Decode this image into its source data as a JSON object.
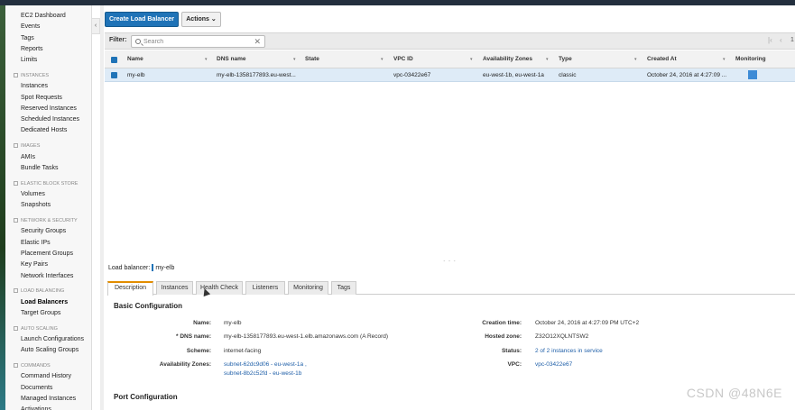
{
  "sidebar": {
    "items": [
      {
        "kind": "link",
        "label": "EC2 Dashboard",
        "name": "sidebar-item-ec2-dashboard"
      },
      {
        "kind": "link",
        "label": "Events",
        "name": "sidebar-item-events"
      },
      {
        "kind": "link",
        "label": "Tags",
        "name": "sidebar-item-tags"
      },
      {
        "kind": "link",
        "label": "Reports",
        "name": "sidebar-item-reports"
      },
      {
        "kind": "link",
        "label": "Limits",
        "name": "sidebar-item-limits"
      },
      {
        "kind": "section",
        "label": "INSTANCES",
        "name": "sidebar-section-instances"
      },
      {
        "kind": "link",
        "label": "Instances",
        "name": "sidebar-item-instances"
      },
      {
        "kind": "link",
        "label": "Spot Requests",
        "name": "sidebar-item-spot-requests"
      },
      {
        "kind": "link",
        "label": "Reserved Instances",
        "name": "sidebar-item-reserved-instances"
      },
      {
        "kind": "link",
        "label": "Scheduled Instances",
        "name": "sidebar-item-scheduled-instances"
      },
      {
        "kind": "link",
        "label": "Dedicated Hosts",
        "name": "sidebar-item-dedicated-hosts"
      },
      {
        "kind": "section",
        "label": "IMAGES",
        "name": "sidebar-section-images"
      },
      {
        "kind": "link",
        "label": "AMIs",
        "name": "sidebar-item-amis"
      },
      {
        "kind": "link",
        "label": "Bundle Tasks",
        "name": "sidebar-item-bundle-tasks"
      },
      {
        "kind": "section",
        "label": "ELASTIC BLOCK STORE",
        "name": "sidebar-section-ebs"
      },
      {
        "kind": "link",
        "label": "Volumes",
        "name": "sidebar-item-volumes"
      },
      {
        "kind": "link",
        "label": "Snapshots",
        "name": "sidebar-item-snapshots"
      },
      {
        "kind": "section",
        "label": "NETWORK & SECURITY",
        "name": "sidebar-section-network-security"
      },
      {
        "kind": "link",
        "label": "Security Groups",
        "name": "sidebar-item-security-groups"
      },
      {
        "kind": "link",
        "label": "Elastic IPs",
        "name": "sidebar-item-elastic-ips"
      },
      {
        "kind": "link",
        "label": "Placement Groups",
        "name": "sidebar-item-placement-groups"
      },
      {
        "kind": "link",
        "label": "Key Pairs",
        "name": "sidebar-item-key-pairs"
      },
      {
        "kind": "link",
        "label": "Network Interfaces",
        "name": "sidebar-item-network-interfaces"
      },
      {
        "kind": "section",
        "label": "LOAD BALANCING",
        "name": "sidebar-section-load-balancing"
      },
      {
        "kind": "link",
        "label": "Load Balancers",
        "name": "sidebar-item-load-balancers",
        "active": true
      },
      {
        "kind": "link",
        "label": "Target Groups",
        "name": "sidebar-item-target-groups"
      },
      {
        "kind": "section",
        "label": "AUTO SCALING",
        "name": "sidebar-section-auto-scaling"
      },
      {
        "kind": "link",
        "label": "Launch Configurations",
        "name": "sidebar-item-launch-configurations"
      },
      {
        "kind": "link",
        "label": "Auto Scaling Groups",
        "name": "sidebar-item-auto-scaling-groups"
      },
      {
        "kind": "section",
        "label": "COMMANDS",
        "name": "sidebar-section-commands"
      },
      {
        "kind": "link",
        "label": "Command History",
        "name": "sidebar-item-command-history"
      },
      {
        "kind": "link",
        "label": "Documents",
        "name": "sidebar-item-documents"
      },
      {
        "kind": "link",
        "label": "Managed Instances",
        "name": "sidebar-item-managed-instances"
      },
      {
        "kind": "link",
        "label": "Activations",
        "name": "sidebar-item-activations"
      }
    ]
  },
  "toolbar": {
    "create_label": "Create Load Balancer",
    "actions_label": "Actions",
    "actions_caret": "⌄"
  },
  "filter": {
    "label": "Filter:",
    "placeholder": "Search",
    "value": "",
    "clear_glyph": "✕"
  },
  "pager": {
    "first_glyph": "|‹",
    "prev_glyph": "‹",
    "page": "1"
  },
  "table": {
    "columns": {
      "name": "Name",
      "dns": "DNS name",
      "state": "State",
      "vpc": "VPC ID",
      "az": "Availability Zones",
      "type": "Type",
      "created": "Created At",
      "monitoring": "Monitoring"
    },
    "sort_caret": "▾",
    "row": {
      "name": "my-elb",
      "dns": "my-elb-1358177893.eu-west...",
      "state": "",
      "vpc": "vpc-03422e67",
      "az": "eu-west-1b, eu-west-1a",
      "type": "classic",
      "created": "October 24, 2016 at 4:27:09 ..."
    }
  },
  "splitter_glyph": "- - -",
  "details": {
    "title_label": "Load balancer:",
    "title_name": "my-elb",
    "tabs": [
      "Description",
      "Instances",
      "Health Check",
      "Listeners",
      "Monitoring",
      "Tags"
    ],
    "basic_heading": "Basic Configuration",
    "port_heading": "Port Configuration",
    "left": {
      "name_label": "Name:",
      "name_value": "my-elb",
      "dns_label": "* DNS name:",
      "dns_value": "my-elb-1358177893.eu-west-1.elb.amazonaws.com (A Record)",
      "scheme_label": "Scheme:",
      "scheme_value": "internet-facing",
      "az_label": "Availability Zones:",
      "az_value_1": "subnet-62dc9d06 - eu-west-1a ,",
      "az_value_2": "subnet-8b2c52fd - eu-west-1b"
    },
    "right": {
      "created_label": "Creation time:",
      "created_value": "October 24, 2016 at 4:27:09 PM UTC+2",
      "zone_label": "Hosted zone:",
      "zone_value": "Z32O12XQLNTSW2",
      "status_label": "Status:",
      "status_value": "2 of 2 instances in service",
      "vpc_label": "VPC:",
      "vpc_value": "vpc-03422e67"
    }
  },
  "watermark": "CSDN @48N6E",
  "colors": {
    "primary_button": "#1f73b7",
    "selected_row": "#deebf7",
    "active_tab_accent": "#e28d00",
    "link": "#1f5fa8"
  }
}
